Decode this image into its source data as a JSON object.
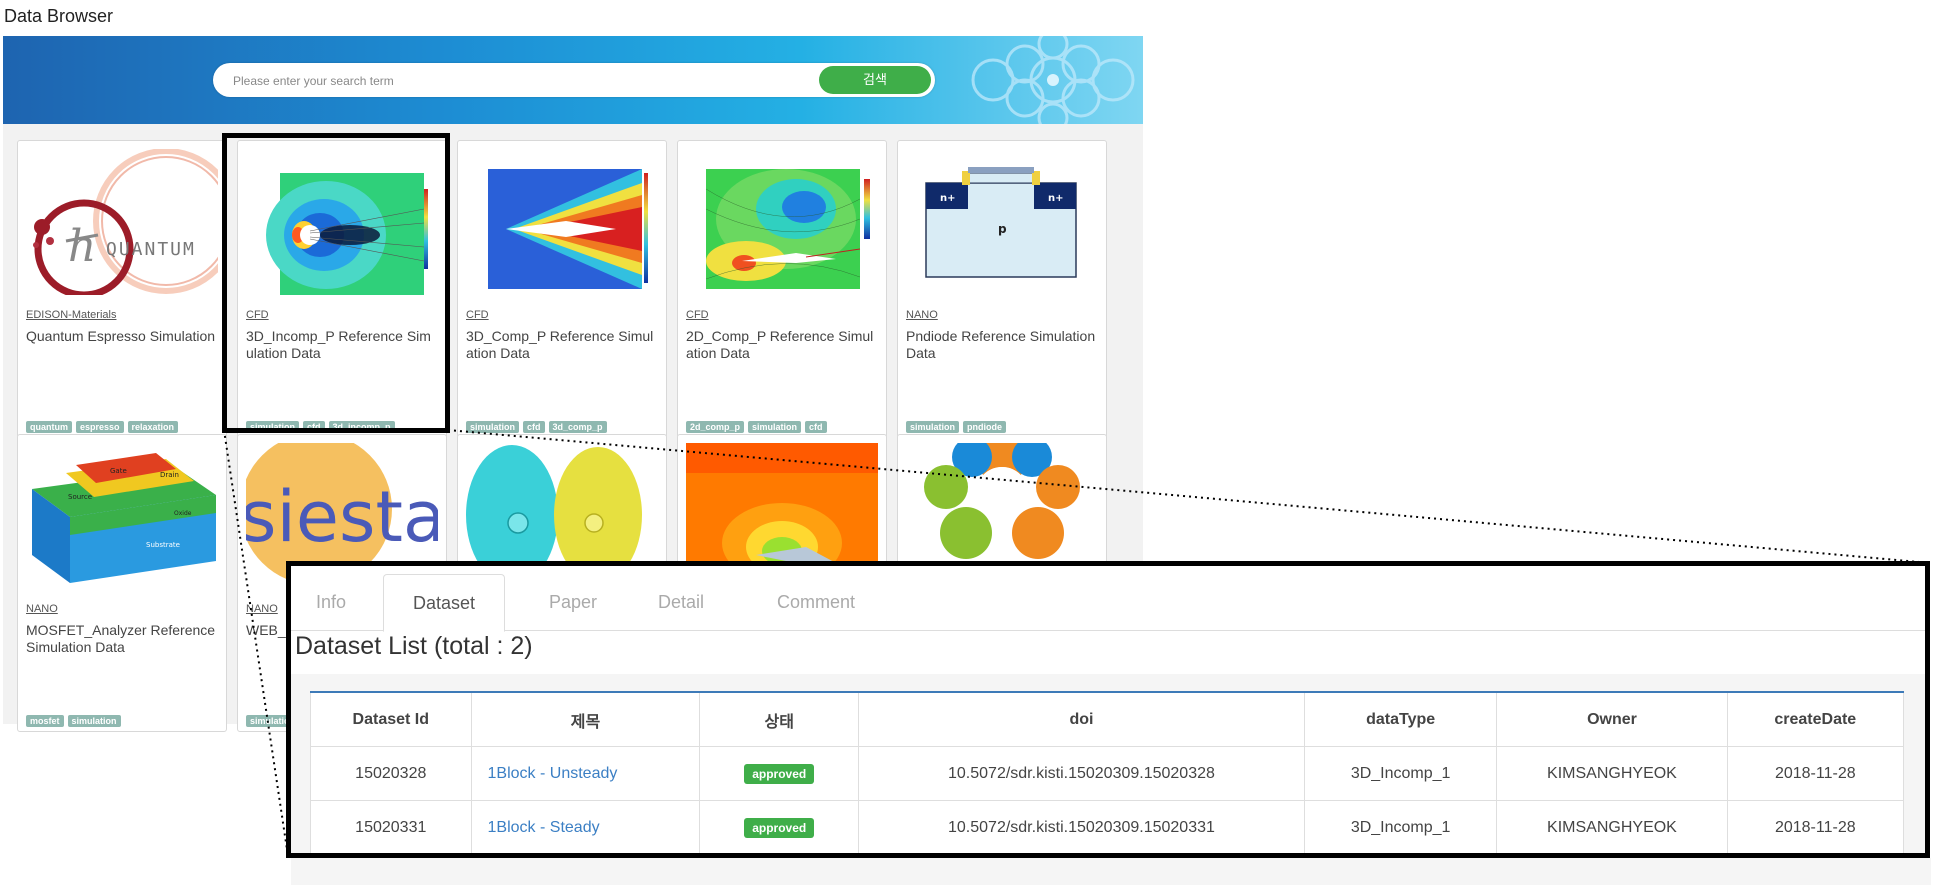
{
  "app": {
    "title": "Data Browser"
  },
  "search": {
    "placeholder": "Please enter your search term",
    "button_label": "검색"
  },
  "cards": [
    {
      "category": "EDISON-Materials",
      "title": "Quantum Espresso Simulation",
      "tags": [
        "quantum",
        "espresso",
        "relaxation"
      ],
      "thumb": "quantum-logo"
    },
    {
      "category": "CFD",
      "title": "3D_Incomp_P Reference Simulation Data",
      "tags": [
        "simulation",
        "cfd",
        "3d_incomp_p"
      ],
      "thumb": "cfd-cylinder-plot"
    },
    {
      "category": "CFD",
      "title": "3D_Comp_P Reference Simulation Data",
      "tags": [
        "simulation",
        "cfd",
        "3d_comp_p"
      ],
      "thumb": "cfd-shock-plot"
    },
    {
      "category": "CFD",
      "title": "2D_Comp_P Reference Simulation Data",
      "tags": [
        "2d_comp_p",
        "simulation",
        "cfd"
      ],
      "thumb": "cfd-airfoil-plot"
    },
    {
      "category": "NANO",
      "title": "Pndiode Reference Simulation Data",
      "tags": [
        "simulation",
        "pndiode"
      ],
      "thumb": "pndiode-diagram",
      "labels": {
        "n1": "n+",
        "n2": "n+",
        "p": "p"
      }
    },
    {
      "category": "NANO",
      "title": "MOSFET_Analyzer Reference Simulation Data",
      "tags": [
        "mosfet",
        "simulation"
      ],
      "thumb": "mosfet-3d",
      "labels": {
        "gate": "Gate",
        "drain": "Drain",
        "source": "Source",
        "oxide": "Oxide",
        "substrate": "Substrate"
      }
    },
    {
      "category": "NANO",
      "title": "WEB_Emulation Data",
      "tags": [
        "simulation"
      ],
      "thumb": "siesta-logo",
      "labels": {
        "logo": "siesta"
      }
    }
  ],
  "detail": {
    "tabs": [
      "Info",
      "Dataset",
      "Paper",
      "Detail",
      "Comment"
    ],
    "active_tab": "Dataset",
    "list_title": "Dataset List (total : 2)",
    "columns": [
      "Dataset Id",
      "제목",
      "상태",
      "doi",
      "dataType",
      "Owner",
      "createDate"
    ],
    "rows": [
      {
        "id": "15020328",
        "title": "1Block - Unsteady",
        "status": "approved",
        "doi": "10.5072/sdr.kisti.15020309.15020328",
        "dataType": "3D_Incomp_1",
        "owner": "KIMSANGHYEOK",
        "createDate": "2018-11-28"
      },
      {
        "id": "15020331",
        "title": "1Block - Steady",
        "status": "approved",
        "doi": "10.5072/sdr.kisti.15020309.15020331",
        "dataType": "3D_Incomp_1",
        "owner": "KIMSANGHYEOK",
        "createDate": "2018-11-28"
      }
    ]
  },
  "colors": {
    "accent_green": "#3fae49",
    "banner_blue": "#1d8ed4",
    "link_blue": "#3b7fc4",
    "tag_teal": "#8fb8b0"
  }
}
